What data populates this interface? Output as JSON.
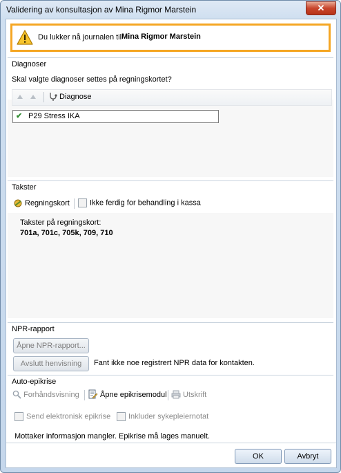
{
  "window": {
    "title": "Validering av konsultasjon av Mina Rigmor Marstein",
    "close_glyph": "✕"
  },
  "warning": {
    "icon": "warning-icon",
    "text": "Du lukker nå journalen til",
    "patient": "Mina Rigmor Marstein",
    "border_color": "#f5a623"
  },
  "diagnoser": {
    "heading": "Diagnoser",
    "question": "Skal valgte diagnoser settes på regningskortet?",
    "toolbar": {
      "column_label": "Diagnose"
    },
    "items": [
      {
        "label": "P29 Stress IKA",
        "checked": true
      }
    ]
  },
  "takster": {
    "heading": "Takster",
    "toolbar": {
      "regningskort_label": "Regningskort",
      "ikke_ferdig_label": "Ikke ferdig for behandling i kassa"
    },
    "summary_title": "Takster på regningskort:",
    "summary_values": "701a, 701c, 705k, 709, 710"
  },
  "npr": {
    "heading": "NPR-rapport",
    "open_button": "Åpne NPR-rapport...",
    "close_referral_button": "Avslutt henvisning",
    "status_text": "Fant ikke noe registrert NPR data for kontakten."
  },
  "epikrise": {
    "heading": "Auto-epikrise",
    "preview_label": "Forhåndsvisning",
    "open_module_label": "Åpne epikrisemodul",
    "print_label": "Utskrift",
    "send_electronic_label": "Send elektronisk epikrise",
    "include_nurse_note_label": "Inkluder sykepleiernotat",
    "info_text": "Mottaker informasjon mangler. Epikrise må lages manuelt."
  },
  "footer": {
    "ok_label": "OK",
    "cancel_label": "Avbryt"
  }
}
